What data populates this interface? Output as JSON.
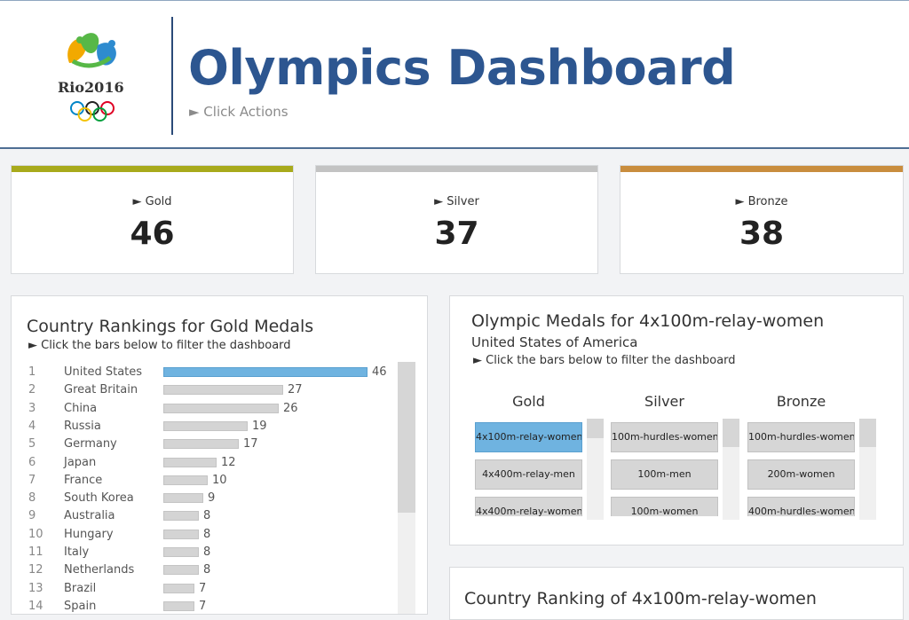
{
  "header": {
    "title": "Olympics Dashboard",
    "subtitle": "► Click Actions",
    "logo_text": "Rio2016"
  },
  "kpis": [
    {
      "label": "► Gold",
      "value": "46",
      "color": "#a8aa1c"
    },
    {
      "label": "► Silver",
      "value": "37",
      "color": "#c3c3c3"
    },
    {
      "label": "► Bronze",
      "value": "38",
      "color": "#c98d3e"
    }
  ],
  "rankings": {
    "title": "Country Rankings for Gold Medals",
    "hint": "► Click the bars below to filter the dashboard",
    "max_value": 46,
    "rows": [
      {
        "rank": "1",
        "country": "United States",
        "value": 46,
        "selected": true
      },
      {
        "rank": "2",
        "country": "Great Britain",
        "value": 27
      },
      {
        "rank": "3",
        "country": "China",
        "value": 26
      },
      {
        "rank": "4",
        "country": "Russia",
        "value": 19
      },
      {
        "rank": "5",
        "country": "Germany",
        "value": 17
      },
      {
        "rank": "6",
        "country": "Japan",
        "value": 12
      },
      {
        "rank": "7",
        "country": "France",
        "value": 10
      },
      {
        "rank": "8",
        "country": "South Korea",
        "value": 9
      },
      {
        "rank": "9",
        "country": "Australia",
        "value": 8
      },
      {
        "rank": "10",
        "country": "Hungary",
        "value": 8
      },
      {
        "rank": "11",
        "country": "Italy",
        "value": 8
      },
      {
        "rank": "12",
        "country": "Netherlands",
        "value": 8
      },
      {
        "rank": "13",
        "country": "Brazil",
        "value": 7
      },
      {
        "rank": "14",
        "country": "Spain",
        "value": 7
      }
    ]
  },
  "medals_panel": {
    "title": "Olympic Medals for 4x100m-relay-women",
    "country": "United States of America",
    "hint": "► Click the bars below to filter the dashboard",
    "columns": [
      {
        "header": "Gold",
        "items": [
          "4x100m-relay-women",
          "4x400m-relay-men",
          "4x400m-relay-women"
        ],
        "selected_index": 0
      },
      {
        "header": "Silver",
        "items": [
          "100m-hurdles-women",
          "100m-men",
          "100m-women"
        ],
        "selected_index": -1
      },
      {
        "header": "Bronze",
        "items": [
          "100m-hurdles-women",
          "200m-women",
          "400m-hurdles-women"
        ],
        "selected_index": -1
      }
    ]
  },
  "country_ranking_panel": {
    "title": "Country Ranking of 4x100m-relay-women"
  }
}
